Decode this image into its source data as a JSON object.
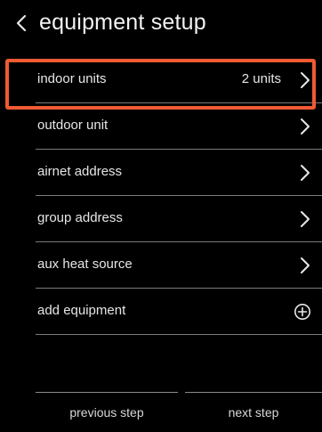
{
  "header": {
    "back_icon": "chevron-left-icon",
    "title": "equipment setup"
  },
  "list": {
    "items": [
      {
        "label": "indoor units",
        "value": "2 units",
        "icon": "chevron-right-icon",
        "highlighted": true
      },
      {
        "label": "outdoor unit",
        "value": "",
        "icon": "chevron-right-icon"
      },
      {
        "label": "airnet address",
        "value": "",
        "icon": "chevron-right-icon"
      },
      {
        "label": "group address",
        "value": "",
        "icon": "chevron-right-icon"
      },
      {
        "label": "aux heat source",
        "value": "",
        "icon": "chevron-right-icon"
      },
      {
        "label": "add equipment",
        "value": "",
        "icon": "plus-circle-icon"
      }
    ]
  },
  "footer": {
    "previous_label": "previous step",
    "next_label": "next step"
  },
  "colors": {
    "background": "#000000",
    "text": "#e6e6e6",
    "divider": "#7a7a7a",
    "highlight": "#ef5a32"
  }
}
